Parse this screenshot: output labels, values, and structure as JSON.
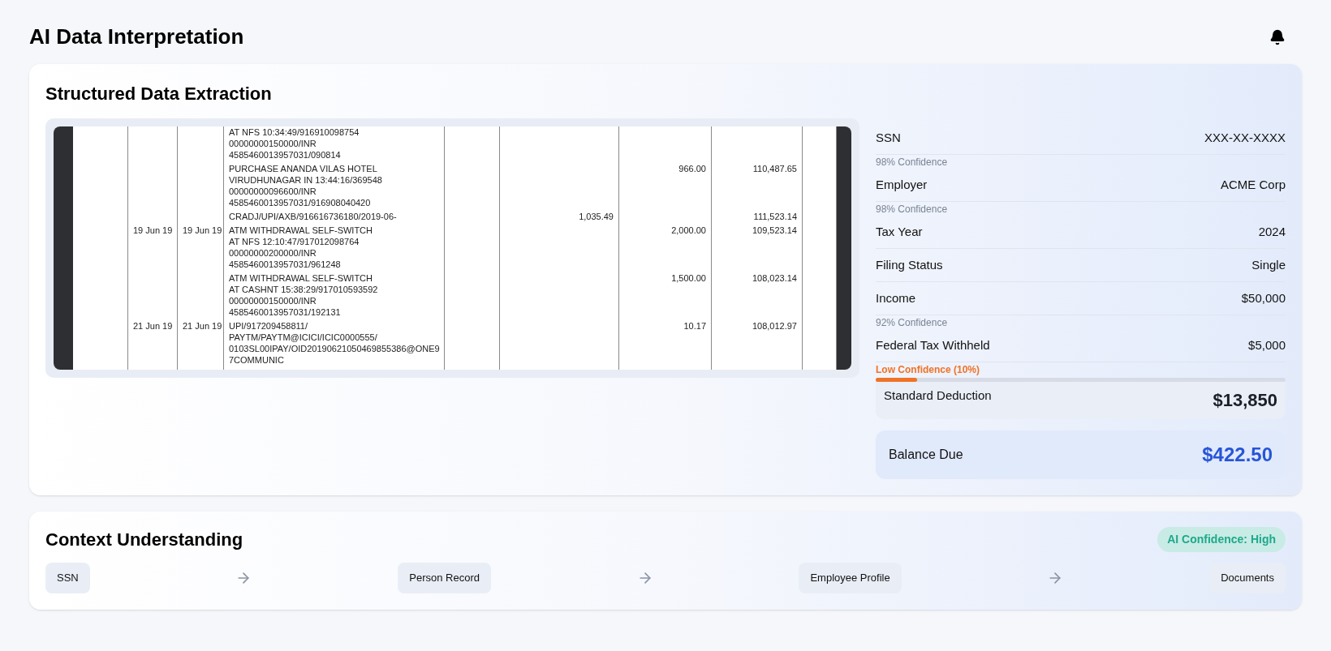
{
  "page": {
    "title": "AI Data Interpretation"
  },
  "extraction": {
    "title": "Structured Data Extraction",
    "document_rows": [
      {
        "description": [
          "AT NFS 10:34:49/916910098754",
          "00000000150000/INR",
          "4585460013957031/090814"
        ]
      },
      {
        "description": [
          "PURCHASE ANANDA VILAS HOTEL",
          "VIRUDHUNAGAR IN 13:44:16/369548",
          "00000000096600/INR",
          "4585460013957031/916908040420"
        ],
        "debit": "966.00",
        "balance": "110,487.65"
      },
      {
        "description": [
          "CRADJ/UPI/AXB/916616736180/2019-06-"
        ],
        "credit": "1,035.49",
        "balance": "111,523.14"
      },
      {
        "date_1": "19 Jun 19",
        "date_2": "19 Jun 19",
        "description": [
          "ATM WITHDRAWAL SELF-SWITCH",
          "AT NFS 12:10:47/917012098764",
          "00000000200000/INR",
          "4585460013957031/961248"
        ],
        "debit": "2,000.00",
        "balance": "109,523.14"
      },
      {
        "description": [
          "ATM WITHDRAWAL SELF-SWITCH",
          "AT CASHNT 15:38:29/917010593592",
          "00000000150000/INR",
          "4585460013957031/192131"
        ],
        "debit": "1,500.00",
        "balance": "108,023.14"
      },
      {
        "date_1": "21 Jun 19",
        "date_2": "21 Jun 19",
        "description": [
          "UPI/917209458811/",
          "PAYTM/PAYTM@ICICI/ICIC0000555/",
          "0103SL00IPAY/OID20190621050469855386@ONE9",
          "7COMMUNIC"
        ],
        "debit": "10.17",
        "balance": "108,012.97"
      }
    ],
    "fields": [
      {
        "label": "SSN",
        "value": "XXX-XX-XXXX",
        "confidence": {
          "kind": "normal",
          "text": "98% Confidence"
        }
      },
      {
        "label": "Employer",
        "value": "ACME Corp",
        "confidence": {
          "kind": "normal",
          "text": "98% Confidence"
        }
      },
      {
        "label": "Tax Year",
        "value": "2024"
      },
      {
        "label": "Filing Status",
        "value": "Single"
      },
      {
        "label": "Income",
        "value": "$50,000",
        "confidence": {
          "kind": "normal",
          "text": "92% Confidence"
        }
      },
      {
        "label": "Federal Tax Withheld",
        "value": "$5,000",
        "confidence": {
          "kind": "low",
          "text": "Low Confidence (10%)",
          "level": 0.1
        }
      }
    ],
    "summary": [
      {
        "kind": "plain",
        "label": "Standard Deduction",
        "value": "$13,850"
      },
      {
        "kind": "highlight",
        "label": "Balance Due",
        "value": "$422.50"
      }
    ]
  },
  "context": {
    "title": "Context Understanding",
    "badge": "AI Confidence: High",
    "nodes": [
      "SSN",
      "Person Record",
      "Employee Profile",
      "Documents"
    ]
  }
}
